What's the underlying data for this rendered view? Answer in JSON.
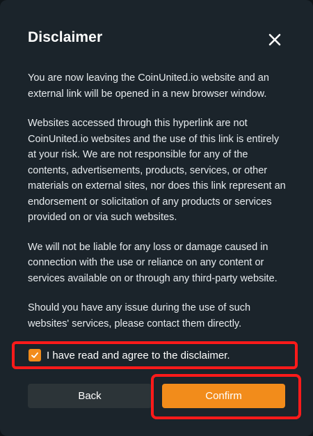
{
  "modal": {
    "title": "Disclaimer",
    "close_icon": "close-icon"
  },
  "body": {
    "paragraphs": [
      "You are now leaving the CoinUnited.io website and an external link will be opened in a new browser window.",
      "Websites accessed through this hyperlink are not CoinUnited.io websites and the use of this link is entirely at your risk. We are not responsible for any of the contents, advertisements, products, services, or other materials on external sites, nor does this link represent an endorsement or solicitation of any products or services provided on or via such websites.",
      "We will not be liable for any loss or damage caused in connection with the use or reliance on any content or services available on or through any third-party website.",
      "Should you have any issue during the use of such websites' services, please contact them directly."
    ]
  },
  "agreement": {
    "checked": true,
    "label": "I have read and agree to the disclaimer."
  },
  "actions": {
    "back_label": "Back",
    "confirm_label": "Confirm"
  },
  "colors": {
    "accent": "#f28c1b",
    "highlight": "#ff1a1a",
    "background": "#1b242b",
    "secondary_button": "#2c3438"
  }
}
